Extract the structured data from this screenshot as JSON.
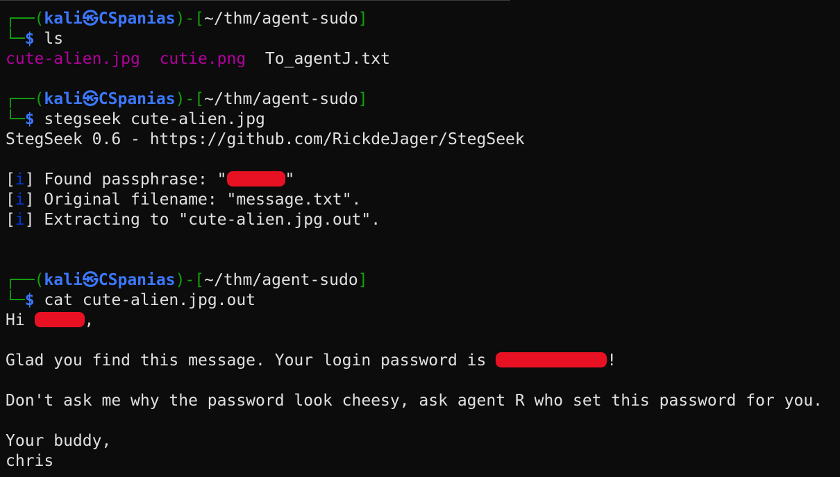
{
  "prompt": {
    "corner_top": "┌──",
    "corner_bottom": "└─",
    "open_paren": "(",
    "user": "kali",
    "at_symbol": "㉿",
    "host": "CSpanias",
    "close_paren_dash": ")-",
    "open_bracket": "[",
    "path": "~/thm/agent-sudo",
    "close_bracket": "]",
    "dollar": "$"
  },
  "commands": {
    "cmd1": "ls",
    "cmd2": "stegseek cute-alien.jpg",
    "cmd3": "cat cute-alien.jpg.out"
  },
  "ls_output": {
    "file1": "cute-alien.jpg",
    "file2": "cutie.png",
    "file3": "To_agentJ.txt"
  },
  "stegseek_output": {
    "banner": "StegSeek 0.6 - https://github.com/RickdeJager/StegSeek",
    "info_open": "[",
    "info_i": "i",
    "info_close": "]",
    "found_prefix": " Found passphrase: \"",
    "found_suffix": "\"",
    "original_filename": " Original filename: \"message.txt\".",
    "extracting": " Extracting to \"cute-alien.jpg.out\"."
  },
  "message": {
    "greeting_prefix": "Hi ",
    "greeting_suffix": ",",
    "glad_prefix": "Glad you find this message. Your login password is ",
    "glad_suffix": "!",
    "dont_ask": "Don't ask me why the password look cheesy, ask agent R who set this password for you.",
    "sign_off": "Your buddy,",
    "signature": "chris"
  },
  "colors": {
    "background": "#0c0c0c",
    "prompt_frame": "#13a10e",
    "prompt_user_host": "#3b78ff",
    "image_files": "#b4009e",
    "info_marker": "#0037da",
    "redaction": "#e81123"
  }
}
